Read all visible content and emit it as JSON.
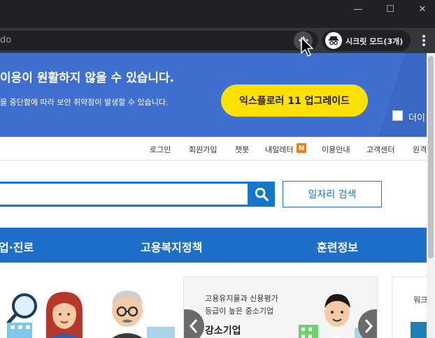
{
  "browser": {
    "address_text": "do",
    "incognito_label": "시크릿 모드(3개)",
    "window_minimize": "—",
    "window_maximize": "☐",
    "window_close": "✕",
    "icons": [
      "star-icon",
      "incognito-icon",
      "menu-icon",
      "cursor-icon"
    ]
  },
  "ie_banner": {
    "title": "이용이 원활하지 않을 수 있습니다.",
    "subtitle": "을 중단함에 따라 보안 취약점이 발생할 수 있습니다.",
    "upgrade_button": "익스플로러 11 업그레이드",
    "checkbox_label": "더이"
  },
  "utility_links": [
    "로그인",
    "회원가입",
    "챗봇",
    "내일레터",
    "이용안내",
    "고객센터",
    "원격"
  ],
  "utility_badge": "N",
  "search": {
    "job_search_button": "일자리 검색",
    "accent_color": "#1477c9"
  },
  "main_nav": [
    "업·진로",
    "고용복지정책",
    "훈련정보"
  ],
  "promo": {
    "line1": "고용유지율과 신용평가",
    "line2": "등급이 높은 중소기업",
    "title": "강소기업"
  },
  "side_card": {
    "text": "워크"
  },
  "colors": {
    "banner_blue": "#3f6fcf",
    "nav_blue": "#1e6fc8",
    "upgrade_yellow": "#ffe100",
    "badge_orange": "#f27d12"
  }
}
